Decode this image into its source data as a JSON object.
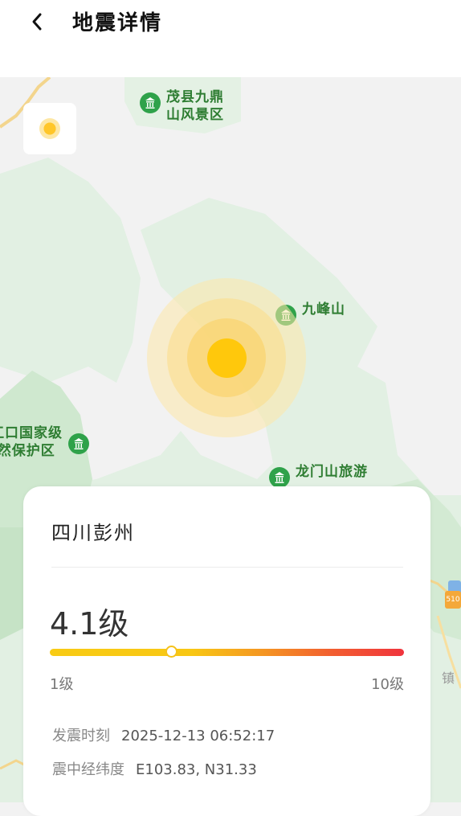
{
  "header": {
    "title": "地震详情",
    "back_icon": "chevron-left-icon"
  },
  "map": {
    "pois": [
      {
        "name": "茂县九鼎\n山风景区"
      },
      {
        "name": "九峰山"
      },
      {
        "name": "江口国家级\n自然保护区",
        "visible_text": "江口国家级\n)然保护区"
      },
      {
        "name": "龙门山旅游"
      }
    ],
    "edge_label": "镇",
    "road_badge": "510"
  },
  "card": {
    "location": "四川彭州",
    "magnitude": "4.1级",
    "scale": {
      "min_label": "1级",
      "max_label": "10级",
      "min": 1,
      "max": 10,
      "value": 4.1
    },
    "time_label": "发震时刻",
    "time_value": "2025-12-13 06:52:17",
    "coord_label": "震中经纬度",
    "coord_value": "E103.83, N31.33"
  },
  "colors": {
    "accent": "#ffc629",
    "poi_green": "#2e7d32",
    "bar_start": "#f8cb14",
    "bar_end": "#f0343d"
  }
}
